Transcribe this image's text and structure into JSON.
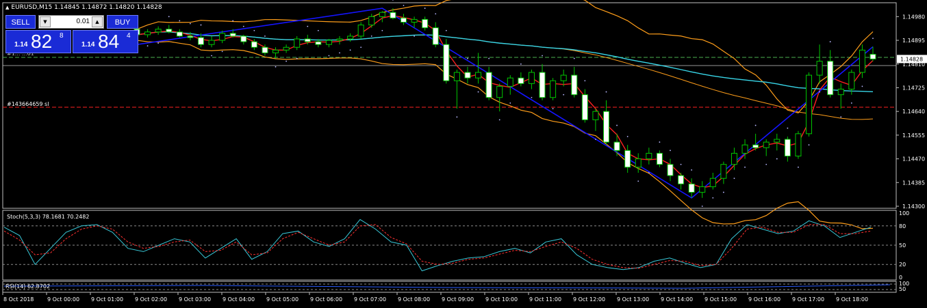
{
  "window": {
    "title": "EURUSD,M15  1.14845 1.14872 1.14820 1.14828"
  },
  "trade_panel": {
    "sell_label": "SELL",
    "buy_label": "BUY",
    "lot_value": "0.01",
    "sell_price_prefix": "1.14",
    "sell_price_big": "82",
    "sell_price_sup": "8",
    "buy_price_prefix": "1.14",
    "buy_price_big": "84",
    "buy_price_sup": "4"
  },
  "main_chart": {
    "price_axis": [
      "1.14980",
      "1.14895",
      "1.14810",
      "1.14725",
      "1.14640",
      "1.14555",
      "1.14470",
      "1.14385",
      "1.14300"
    ],
    "current_price": "1.14828",
    "order_label": "#143664659 sl",
    "line_label_partial": "#1... ...01",
    "colors": {
      "bull_candle": "#00c800",
      "bear_candle": "#ffffff",
      "zigzag": "#1414ff",
      "bollinger": "#ff9e1a",
      "ma_red": "#ff2020",
      "ma_cyan": "#38d6e8",
      "sl_line": "#ff2020",
      "psar": "#b8b8ff"
    }
  },
  "stoch": {
    "label": "Stoch(5,3,3) 78.1681 70.2482",
    "levels": [
      "100",
      "80",
      "50",
      "20",
      "0"
    ]
  },
  "rsi": {
    "label": "RSI(14) 62.8702",
    "levels": [
      "100",
      "50"
    ]
  },
  "time_axis": [
    "8 Oct 2018",
    "9 Oct 00:00",
    "9 Oct 01:00",
    "9 Oct 02:00",
    "9 Oct 03:00",
    "9 Oct 04:00",
    "9 Oct 05:00",
    "9 Oct 06:00",
    "9 Oct 07:00",
    "9 Oct 08:00",
    "9 Oct 09:00",
    "9 Oct 10:00",
    "9 Oct 11:00",
    "9 Oct 12:00",
    "9 Oct 13:00",
    "9 Oct 14:00",
    "9 Oct 15:00",
    "9 Oct 16:00",
    "9 Oct 17:00",
    "9 Oct 18:00"
  ],
  "chart_data": {
    "type": "candlestick",
    "symbol": "EURUSD",
    "timeframe": "M15",
    "open": 1.14845,
    "high": 1.14872,
    "low": 1.1482,
    "close": 1.14828,
    "ylim": [
      1.143,
      1.1502
    ],
    "candles": [
      [
        1.14935,
        1.14945,
        1.14905,
        1.14915
      ],
      [
        1.14915,
        1.14935,
        1.14905,
        1.14925
      ],
      [
        1.14925,
        1.14945,
        1.14915,
        1.14935
      ],
      [
        1.14935,
        1.1495,
        1.1492,
        1.14925
      ],
      [
        1.14925,
        1.14935,
        1.14905,
        1.1491
      ],
      [
        1.1491,
        1.14925,
        1.14895,
        1.14905
      ],
      [
        1.14905,
        1.1492,
        1.1487,
        1.1488
      ],
      [
        1.1488,
        1.1491,
        1.1487,
        1.14895
      ],
      [
        1.14895,
        1.1493,
        1.14885,
        1.1492
      ],
      [
        1.1492,
        1.14935,
        1.14905,
        1.1491
      ],
      [
        1.1491,
        1.14915,
        1.1488,
        1.1489
      ],
      [
        1.1489,
        1.149,
        1.1486,
        1.1487
      ],
      [
        1.1487,
        1.1488,
        1.1484,
        1.1485
      ],
      [
        1.1485,
        1.1487,
        1.1483,
        1.1486
      ],
      [
        1.1486,
        1.1488,
        1.1485,
        1.1487
      ],
      [
        1.1487,
        1.1491,
        1.1486,
        1.149
      ],
      [
        1.149,
        1.14915,
        1.1488,
        1.1489
      ],
      [
        1.1489,
        1.149,
        1.1487,
        1.1488
      ],
      [
        1.1488,
        1.149,
        1.1487,
        1.14895
      ],
      [
        1.14895,
        1.1491,
        1.1488,
        1.149
      ],
      [
        1.149,
        1.1492,
        1.1489,
        1.1491
      ],
      [
        1.1491,
        1.1496,
        1.149,
        1.1495
      ],
      [
        1.1495,
        1.1499,
        1.1494,
        1.1498
      ],
      [
        1.1498,
        1.15,
        1.1496,
        1.14995
      ],
      [
        1.14995,
        1.1501,
        1.1497,
        1.14975
      ],
      [
        1.14975,
        1.1499,
        1.1495,
        1.1496
      ],
      [
        1.1496,
        1.1498,
        1.1494,
        1.1497
      ],
      [
        1.1497,
        1.1498,
        1.1493,
        1.1494
      ],
      [
        1.1494,
        1.1496,
        1.1487,
        1.1488
      ],
      [
        1.1488,
        1.149,
        1.1474,
        1.1475
      ],
      [
        1.1475,
        1.1479,
        1.1465,
        1.1478
      ],
      [
        1.1478,
        1.148,
        1.1474,
        1.1476
      ],
      [
        1.1476,
        1.1485,
        1.1474,
        1.1478
      ],
      [
        1.1478,
        1.148,
        1.1468,
        1.1469
      ],
      [
        1.1469,
        1.1474,
        1.1464,
        1.1473
      ],
      [
        1.1473,
        1.1477,
        1.147,
        1.1476
      ],
      [
        1.1476,
        1.1478,
        1.1473,
        1.1474
      ],
      [
        1.1474,
        1.1479,
        1.1472,
        1.1478
      ],
      [
        1.1478,
        1.1481,
        1.1468,
        1.1469
      ],
      [
        1.1469,
        1.1476,
        1.1468,
        1.1475
      ],
      [
        1.1475,
        1.1479,
        1.1473,
        1.1477
      ],
      [
        1.1477,
        1.148,
        1.1469,
        1.147
      ],
      [
        1.147,
        1.1472,
        1.146,
        1.1461
      ],
      [
        1.1461,
        1.1465,
        1.1457,
        1.1464
      ],
      [
        1.1464,
        1.1468,
        1.1452,
        1.1453
      ],
      [
        1.1453,
        1.1456,
        1.1448,
        1.145
      ],
      [
        1.145,
        1.1452,
        1.1442,
        1.1444
      ],
      [
        1.1444,
        1.1449,
        1.1442,
        1.1447
      ],
      [
        1.1447,
        1.1451,
        1.1445,
        1.1449
      ],
      [
        1.1449,
        1.145,
        1.1444,
        1.1445
      ],
      [
        1.1445,
        1.1447,
        1.1439,
        1.1441
      ],
      [
        1.1441,
        1.1442,
        1.1436,
        1.1438
      ],
      [
        1.1438,
        1.144,
        1.1433,
        1.1435
      ],
      [
        1.1435,
        1.1439,
        1.1433,
        1.1437
      ],
      [
        1.1437,
        1.1442,
        1.1436,
        1.144
      ],
      [
        1.144,
        1.1446,
        1.1438,
        1.1445
      ],
      [
        1.1445,
        1.1451,
        1.1443,
        1.1449
      ],
      [
        1.1449,
        1.1454,
        1.1447,
        1.1452
      ],
      [
        1.1452,
        1.1456,
        1.145,
        1.1451
      ],
      [
        1.1451,
        1.1454,
        1.1448,
        1.1453
      ],
      [
        1.1453,
        1.1456,
        1.145,
        1.1454
      ],
      [
        1.1454,
        1.1455,
        1.1446,
        1.1448
      ],
      [
        1.1448,
        1.1457,
        1.1447,
        1.1456
      ],
      [
        1.1456,
        1.1478,
        1.1455,
        1.1477
      ],
      [
        1.1477,
        1.1488,
        1.1474,
        1.1482
      ],
      [
        1.1482,
        1.1486,
        1.1469,
        1.147
      ],
      [
        1.147,
        1.1474,
        1.1465,
        1.1472
      ],
      [
        1.1472,
        1.1479,
        1.147,
        1.1478
      ],
      [
        1.1478,
        1.1488,
        1.1476,
        1.1486
      ],
      [
        1.14845,
        1.14872,
        1.1482,
        1.14828
      ]
    ],
    "stoch_main": [
      78,
      65,
      20,
      45,
      70,
      80,
      82,
      70,
      45,
      40,
      50,
      60,
      55,
      30,
      45,
      60,
      28,
      40,
      68,
      72,
      55,
      48,
      60,
      90,
      75,
      55,
      50,
      10,
      18,
      25,
      30,
      32,
      40,
      45,
      38,
      55,
      60,
      35,
      20,
      15,
      12,
      15,
      25,
      30,
      22,
      15,
      20,
      60,
      82,
      75,
      68,
      72,
      88,
      80,
      62,
      70,
      78
    ],
    "stoch_signal": [
      72,
      58,
      35,
      38,
      60,
      75,
      80,
      75,
      55,
      45,
      48,
      55,
      58,
      40,
      42,
      55,
      35,
      38,
      60,
      70,
      60,
      50,
      55,
      80,
      82,
      62,
      52,
      25,
      20,
      22,
      28,
      30,
      36,
      42,
      40,
      48,
      55,
      45,
      28,
      20,
      15,
      14,
      20,
      26,
      25,
      18,
      20,
      45,
      75,
      78,
      70,
      70,
      82,
      82,
      68,
      68,
      72
    ]
  }
}
